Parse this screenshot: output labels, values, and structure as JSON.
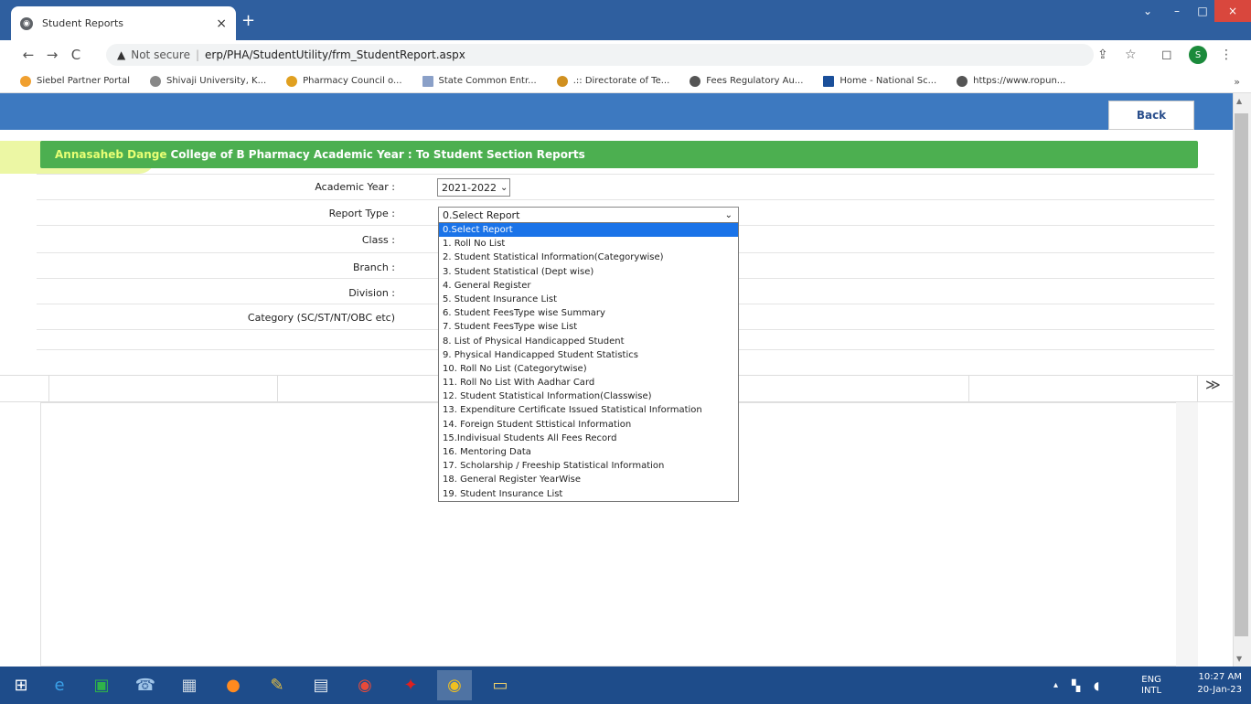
{
  "browser": {
    "tab_title": "Student Reports",
    "tab_close": "×",
    "new_tab": "+",
    "window_controls": [
      "⌄",
      "–",
      "□",
      "×"
    ],
    "back": "←",
    "forward": "→",
    "reload": "C",
    "security_icon": "▲",
    "not_secure": "Not secure",
    "separator": "|",
    "url": "erp/PHA/StudentUtility/frm_StudentReport.aspx",
    "profile_initial": "S",
    "toolbar_icons": [
      "⇪",
      "☆",
      "◻",
      "⋮"
    ]
  },
  "bookmarks": [
    {
      "label": "Siebel Partner Portal",
      "color": "#f0a030"
    },
    {
      "label": "Shivaji University, K...",
      "color": "#888888"
    },
    {
      "label": "Pharmacy Council o...",
      "color": "#e0a020"
    },
    {
      "label": "State Common Entr...",
      "color": "#8aa0c8"
    },
    {
      "label": ".:: Directorate of Te...",
      "color": "#d09020"
    },
    {
      "label": "Fees Regulatory Au...",
      "color": "#555555"
    },
    {
      "label": "Home - National Sc...",
      "color": "#1a4f9a"
    },
    {
      "label": "https://www.ropun...",
      "color": "#555555"
    }
  ],
  "bookmarks_more": "»",
  "page": {
    "back_label": "Back",
    "header_college": "Annasaheb Dange",
    "header_rest": "College of B Pharmacy Academic Year : To Student Section Reports",
    "labels": {
      "academic_year": "Academic Year :",
      "report_type": "Report Type :",
      "class": "Class :",
      "branch": "Branch :",
      "division": "Division :",
      "category": "Category (SC/ST/NT/OBC etc)"
    },
    "academic_year_value": "2021-2022",
    "report_type_value": "0.Select Report",
    "select_arrow": "⌄",
    "expand_icon": "≫"
  },
  "report_options": [
    "0.Select Report",
    "1. Roll No List",
    "2. Student Statistical Information(Categorywise)",
    "3. Student Statistical (Dept wise)",
    "4. General Register",
    "5. Student Insurance List",
    "6. Student FeesType wise Summary",
    "7. Student FeesType wise List",
    "8. List of Physical Handicapped Student",
    "9. Physical Handicapped Student Statistics",
    "10. Roll No List (Categorytwise)",
    "11. Roll No List With Aadhar Card",
    "12. Student Statistical Information(Classwise)",
    "13. Expenditure Certificate Issued Statistical Information",
    "14. Foreign Student Sttistical Information",
    "15.Indivisual Students All Fees Record",
    "16. Mentoring Data",
    "17. Scholarship / Freeship Statistical Information",
    "18. General Register YearWise",
    "19. Student Insurance List"
  ],
  "taskbar": {
    "apps": [
      {
        "name": "windows-start",
        "glyph": "⊞",
        "color": "#ffffff"
      },
      {
        "name": "internet-explorer",
        "glyph": "e",
        "color": "#3aa0e8"
      },
      {
        "name": "store",
        "glyph": "▣",
        "color": "#2fb34a"
      },
      {
        "name": "phone-app",
        "glyph": "☎",
        "color": "#9fc4e8"
      },
      {
        "name": "calculator",
        "glyph": "▦",
        "color": "#c8d4e0"
      },
      {
        "name": "firefox",
        "glyph": "●",
        "color": "#ff8a1f"
      },
      {
        "name": "paint",
        "glyph": "✎",
        "color": "#e8c040"
      },
      {
        "name": "word",
        "glyph": "▤",
        "color": "#dfe6ee"
      },
      {
        "name": "chrome",
        "glyph": "◉",
        "color": "#e84a3a"
      },
      {
        "name": "acrobat",
        "glyph": "✦",
        "color": "#e0201e"
      },
      {
        "name": "chrome-profile",
        "glyph": "◉",
        "color": "#f0c020"
      },
      {
        "name": "file-explorer",
        "glyph": "▭",
        "color": "#f2d26a"
      }
    ],
    "tray_up": "▴",
    "lang_top": "ENG",
    "lang_bottom": "INTL",
    "time": "10:27 AM",
    "date": "20-Jan-23"
  }
}
